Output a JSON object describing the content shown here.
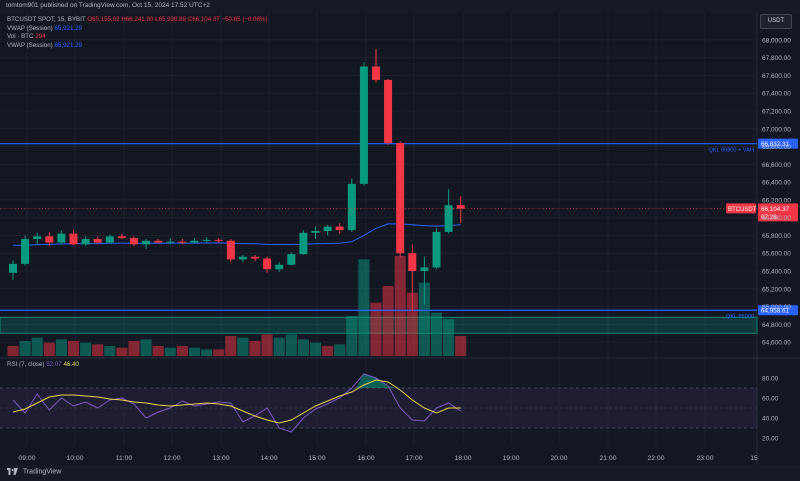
{
  "header": {
    "publisher_line": "tomtom901 published on TradingView.com, Oct 15, 2024 17:52 UTC+2"
  },
  "legend": {
    "symbol": "BTCUSDT SPOT, 15, BYBIT",
    "o": "O65,155.02",
    "h": "H66,241.80",
    "l": "L65,936.88",
    "c": "C66,104.37",
    "chg": "−50.65 (−0.08%)",
    "vwap1_label": "VWAP (Session)",
    "vwap1_value": "65,921.29",
    "vol_label": "Vol · BTC",
    "vol_value": "294",
    "vwap2_label": "VWAP (Session)",
    "vwap2_value": "65,921.29"
  },
  "currency": "USDT",
  "rsi_legend": {
    "label": "RSI (7, close)",
    "v1": "52.07",
    "v2": "46.40"
  },
  "footer": {
    "brand": "TradingView"
  },
  "colors": {
    "up": "#089981",
    "down": "#f23645",
    "vwap": "#2962ff",
    "level": "#2962ff",
    "rsi": "#7e57c2",
    "rsi_ma": "#e8d44d",
    "bg": "#131722"
  },
  "chart_data": {
    "type": "candlestick",
    "symbol": "BTCUSDT",
    "timeframe": "15",
    "price_axis": {
      "min": 64500,
      "max": 68100,
      "ticks": [
        "68,000.00",
        "67,800.00",
        "67,600.00",
        "67,400.00",
        "67,200.00",
        "67,000.00",
        "66,800.00",
        "66,600.00",
        "66,400.00",
        "66,200.00",
        "66,000.00",
        "65,800.00",
        "65,600.00",
        "65,400.00",
        "65,200.00",
        "65,000.00",
        "64,800.00",
        "64,600.00"
      ],
      "tick_values": [
        68000,
        67800,
        67600,
        67400,
        67200,
        67000,
        66800,
        66600,
        66400,
        66200,
        66000,
        65800,
        65600,
        65400,
        65200,
        65000,
        64800,
        64600
      ]
    },
    "time_axis": {
      "ticks": [
        "09:00",
        "10:00",
        "11:00",
        "12:00",
        "13:00",
        "14:00",
        "15:00",
        "16:00",
        "17:00",
        "18:00",
        "19:00",
        "20:00",
        "21:00",
        "22:00",
        "23:00",
        "15"
      ]
    },
    "candles": [
      {
        "o": 65380,
        "h": 65520,
        "l": 65300,
        "c": 65480
      },
      {
        "o": 65480,
        "h": 65800,
        "l": 65460,
        "c": 65760
      },
      {
        "o": 65760,
        "h": 65830,
        "l": 65700,
        "c": 65790
      },
      {
        "o": 65790,
        "h": 65840,
        "l": 65680,
        "c": 65720
      },
      {
        "o": 65720,
        "h": 65860,
        "l": 65700,
        "c": 65820
      },
      {
        "o": 65820,
        "h": 65860,
        "l": 65690,
        "c": 65700
      },
      {
        "o": 65700,
        "h": 65790,
        "l": 65680,
        "c": 65760
      },
      {
        "o": 65760,
        "h": 65790,
        "l": 65700,
        "c": 65720
      },
      {
        "o": 65720,
        "h": 65810,
        "l": 65710,
        "c": 65790
      },
      {
        "o": 65790,
        "h": 65820,
        "l": 65760,
        "c": 65770
      },
      {
        "o": 65770,
        "h": 65790,
        "l": 65680,
        "c": 65700
      },
      {
        "o": 65700,
        "h": 65760,
        "l": 65650,
        "c": 65740
      },
      {
        "o": 65740,
        "h": 65760,
        "l": 65710,
        "c": 65720
      },
      {
        "o": 65720,
        "h": 65770,
        "l": 65700,
        "c": 65730
      },
      {
        "o": 65730,
        "h": 65760,
        "l": 65700,
        "c": 65720
      },
      {
        "o": 65720,
        "h": 65770,
        "l": 65710,
        "c": 65740
      },
      {
        "o": 65740,
        "h": 65780,
        "l": 65720,
        "c": 65750
      },
      {
        "o": 65750,
        "h": 65770,
        "l": 65720,
        "c": 65740
      },
      {
        "o": 65740,
        "h": 65760,
        "l": 65500,
        "c": 65530
      },
      {
        "o": 65530,
        "h": 65580,
        "l": 65500,
        "c": 65560
      },
      {
        "o": 65560,
        "h": 65580,
        "l": 65510,
        "c": 65540
      },
      {
        "o": 65540,
        "h": 65560,
        "l": 65380,
        "c": 65420
      },
      {
        "o": 65420,
        "h": 65500,
        "l": 65390,
        "c": 65470
      },
      {
        "o": 65470,
        "h": 65610,
        "l": 65460,
        "c": 65590
      },
      {
        "o": 65590,
        "h": 65860,
        "l": 65580,
        "c": 65830
      },
      {
        "o": 65830,
        "h": 65900,
        "l": 65760,
        "c": 65850
      },
      {
        "o": 65850,
        "h": 65920,
        "l": 65800,
        "c": 65900
      },
      {
        "o": 65900,
        "h": 65940,
        "l": 65820,
        "c": 65860
      },
      {
        "o": 65860,
        "h": 66440,
        "l": 65840,
        "c": 66380
      },
      {
        "o": 66380,
        "h": 67750,
        "l": 66360,
        "c": 67700
      },
      {
        "o": 67700,
        "h": 67900,
        "l": 67520,
        "c": 67550
      },
      {
        "o": 67550,
        "h": 67560,
        "l": 66820,
        "c": 66840
      },
      {
        "o": 66840,
        "h": 66860,
        "l": 65560,
        "c": 65600
      },
      {
        "o": 65600,
        "h": 65700,
        "l": 64950,
        "c": 65400
      },
      {
        "o": 65400,
        "h": 65560,
        "l": 65020,
        "c": 65440
      },
      {
        "o": 65440,
        "h": 65880,
        "l": 65420,
        "c": 65840
      },
      {
        "o": 65840,
        "h": 66320,
        "l": 65820,
        "c": 66140
      },
      {
        "o": 66140,
        "h": 66240,
        "l": 65940,
        "c": 66100
      }
    ],
    "volume": [
      {
        "v": 30,
        "up": false
      },
      {
        "v": 45,
        "up": true
      },
      {
        "v": 55,
        "up": true
      },
      {
        "v": 40,
        "up": false
      },
      {
        "v": 50,
        "up": true
      },
      {
        "v": 45,
        "up": false
      },
      {
        "v": 40,
        "up": true
      },
      {
        "v": 35,
        "up": false
      },
      {
        "v": 30,
        "up": true
      },
      {
        "v": 25,
        "up": false
      },
      {
        "v": 45,
        "up": false
      },
      {
        "v": 50,
        "up": true
      },
      {
        "v": 30,
        "up": false
      },
      {
        "v": 25,
        "up": true
      },
      {
        "v": 30,
        "up": false
      },
      {
        "v": 25,
        "up": true
      },
      {
        "v": 20,
        "up": true
      },
      {
        "v": 20,
        "up": false
      },
      {
        "v": 60,
        "up": false
      },
      {
        "v": 55,
        "up": true
      },
      {
        "v": 45,
        "up": false
      },
      {
        "v": 65,
        "up": false
      },
      {
        "v": 55,
        "up": true
      },
      {
        "v": 65,
        "up": true
      },
      {
        "v": 50,
        "up": true
      },
      {
        "v": 40,
        "up": true
      },
      {
        "v": 30,
        "up": false
      },
      {
        "v": 35,
        "up": true
      },
      {
        "v": 120,
        "up": true
      },
      {
        "v": 290,
        "up": true
      },
      {
        "v": 160,
        "up": false
      },
      {
        "v": 210,
        "up": false
      },
      {
        "v": 300,
        "up": false
      },
      {
        "v": 190,
        "up": false
      },
      {
        "v": 220,
        "up": true
      },
      {
        "v": 130,
        "up": true
      },
      {
        "v": 110,
        "up": true
      },
      {
        "v": 60,
        "up": false
      }
    ],
    "vwap": [
      65690,
      65690,
      65695,
      65700,
      65705,
      65706,
      65708,
      65710,
      65712,
      65713,
      65712,
      65712,
      65712,
      65713,
      65713,
      65714,
      65715,
      65716,
      65712,
      65708,
      65706,
      65700,
      65698,
      65698,
      65702,
      65706,
      65710,
      65712,
      65730,
      65800,
      65880,
      65930,
      65930,
      65920,
      65910,
      65905,
      65910,
      65921
    ],
    "levels": [
      {
        "label": "QKL 66800 + VAH",
        "price": 66832.31,
        "tag": "66,832.31"
      },
      {
        "label": "QKL 65000",
        "price": 64958.61,
        "tag": "64,958.61"
      }
    ],
    "zone": {
      "from": 64700,
      "to": 64880
    },
    "last_price": {
      "symbol": "BTCUSDT",
      "price": 66104.37,
      "tag": "66,104.37",
      "countdown": "07:26"
    },
    "rsi": {
      "label": "RSI (7, close)",
      "ylim": [
        10,
        95
      ],
      "ticks": [
        "80.00",
        "60.00",
        "40.00",
        "20.00"
      ],
      "tick_values": [
        80,
        60,
        40,
        20
      ],
      "bands": [
        70,
        30
      ],
      "rsi": [
        58,
        45,
        64,
        48,
        60,
        52,
        56,
        50,
        58,
        60,
        54,
        40,
        46,
        50,
        57,
        52,
        54,
        56,
        55,
        36,
        42,
        50,
        30,
        26,
        40,
        49,
        54,
        60,
        70,
        84,
        80,
        72,
        50,
        38,
        37,
        50,
        55,
        47
      ],
      "ma": [
        46,
        49,
        55,
        61,
        63,
        63,
        62,
        61,
        59,
        58,
        56,
        55,
        53,
        52,
        53,
        54,
        55,
        54,
        52,
        47,
        42,
        38,
        35,
        38,
        45,
        52,
        57,
        62,
        66,
        73,
        78,
        76,
        68,
        58,
        50,
        45,
        50,
        50
      ]
    }
  }
}
